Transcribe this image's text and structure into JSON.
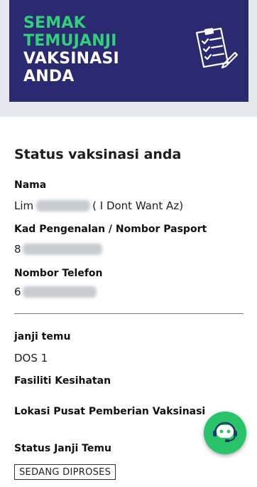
{
  "banner": {
    "title_line1": "SEMAK",
    "title_line2": "TEMUJANJI",
    "title_line3": "VAKSINASI",
    "title_line4": "ANDA",
    "icon": "clipboard-checklist-icon",
    "colors": {
      "background": "#2b2a70",
      "accent": "#31d07a"
    }
  },
  "status": {
    "heading": "Status vaksinasi anda",
    "name_label": "Nama",
    "name_prefix": "Lim",
    "name_suffix": "( I Dont Want Az)",
    "id_label": "Kad Pengenalan / Nombor Pasport",
    "id_value_prefix": "8",
    "phone_label": "Nombor Telefon",
    "phone_value_prefix": "6"
  },
  "appointment": {
    "label": "janji temu",
    "value": "DOS 1",
    "facility_label": "Fasiliti Kesihatan",
    "location_label": "Lokasi Pusat Pemberian Vaksinasi",
    "status_label": "Status Janji Temu",
    "status_value": "SEDANG DIPROSES"
  },
  "chat": {
    "icon": "chatbot-icon",
    "color": "#29c46a"
  }
}
